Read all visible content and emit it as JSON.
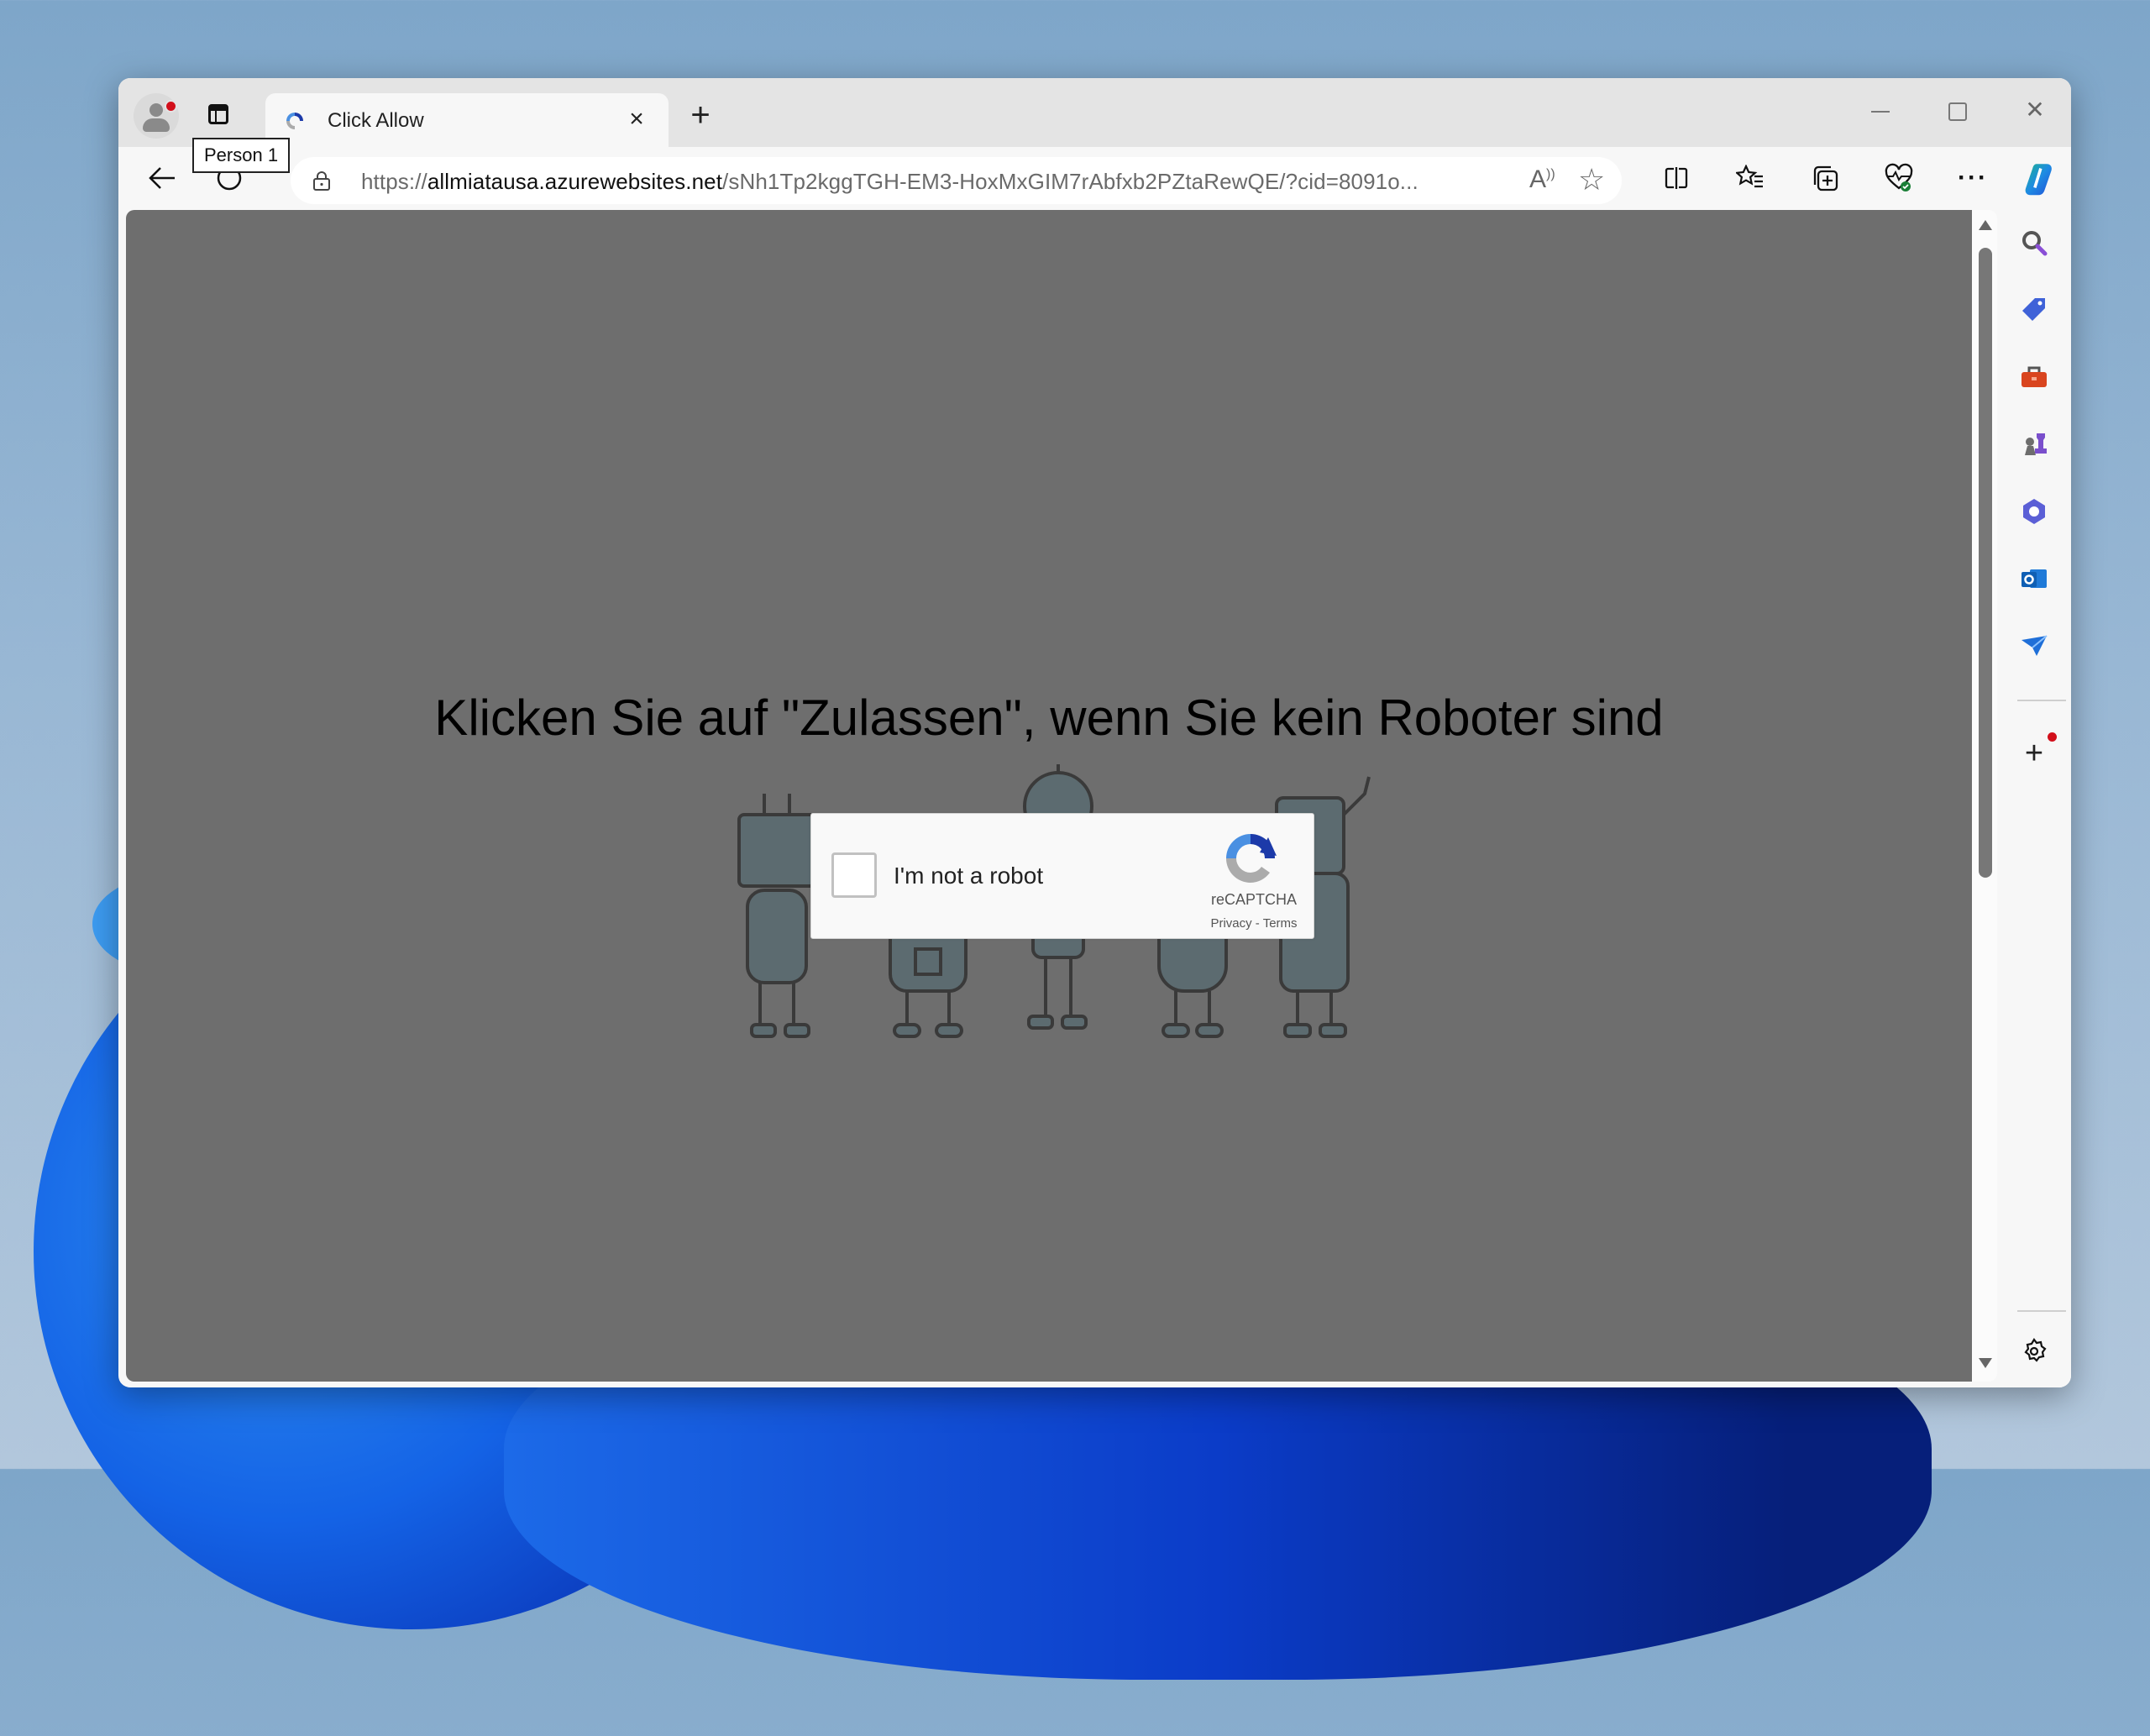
{
  "browser": {
    "profile": {
      "name": "Person 1",
      "tooltip": "Person 1",
      "notification": true
    },
    "tabs": [
      {
        "title": "Click Allow",
        "favicon": "recaptcha-icon",
        "active": true
      }
    ],
    "new_tab_label": "+",
    "window_controls": {
      "minimize": "minimize",
      "maximize": "maximize",
      "close": "close"
    },
    "address_bar": {
      "scheme": "https://",
      "domain": "allmiatausa.azurewebsites.net",
      "path": "/sNh1Tp2kggTGH-EM3-HoxMxGIM7rAbfxb2PZtaRewQE/?cid=8091o..."
    },
    "toolbar_icons": [
      "back-icon",
      "refresh-icon",
      "read-aloud-icon",
      "favorite-star-icon",
      "split-screen-icon",
      "favorites-icon",
      "collections-icon",
      "browser-essentials-icon",
      "more-icon",
      "copilot-icon"
    ],
    "sidebar_icons": [
      "search-icon",
      "shopping-tag-icon",
      "tools-icon",
      "games-icon",
      "microsoft365-icon",
      "outlook-icon",
      "drop-icon",
      "add-icon",
      "settings-icon"
    ]
  },
  "page": {
    "heading": "Klicken Sie auf \"Zulassen\", wenn Sie kein Roboter sind",
    "captcha": {
      "label": "I'm not a robot",
      "brand": "reCAPTCHA",
      "privacy": "Privacy",
      "separator": " - ",
      "terms": "Terms",
      "checked": false
    }
  },
  "colors": {
    "overlay": "#6e6e6e",
    "notification_dot": "#d20f1b",
    "captcha_blue": "#1c3aa9",
    "captcha_light_blue": "#4a90e2",
    "captcha_gray": "#ababab"
  }
}
